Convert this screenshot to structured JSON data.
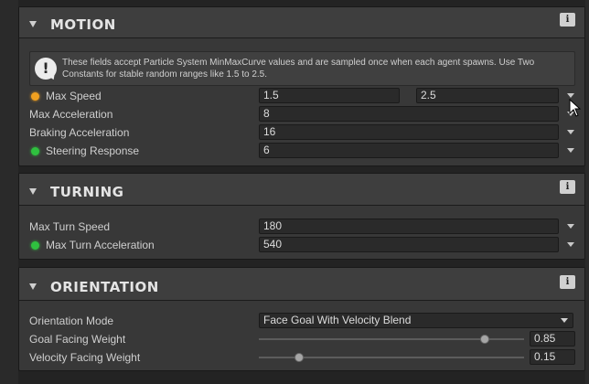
{
  "sections": {
    "motion": {
      "title": "MOTION",
      "info_label": "i",
      "note": "These fields accept Particle System MinMaxCurve values and are sampled once when each agent spawns. Use Two Constants for stable random ranges like 1.5 to 2.5.",
      "rows": [
        {
          "label": "Max Speed",
          "min": "1.5",
          "max": "2.5",
          "dot": "orange"
        },
        {
          "label": "Max Acceleration",
          "value": "8"
        },
        {
          "label": "Braking Acceleration",
          "value": "16"
        },
        {
          "label": "Steering Response",
          "value": "6",
          "dot": "green"
        }
      ]
    },
    "turning": {
      "title": "TURNING",
      "info_label": "i",
      "rows": [
        {
          "label": "Max Turn Speed",
          "value": "180"
        },
        {
          "label": "Max Turn Acceleration",
          "value": "540",
          "dot": "green"
        }
      ]
    },
    "orientation": {
      "title": "ORIENTATION",
      "info_label": "i",
      "rows": [
        {
          "label": "Orientation Mode",
          "value": "Face Goal With Velocity Blend"
        },
        {
          "label": "Goal Facing Weight",
          "value": "0.85",
          "fraction": 0.85
        },
        {
          "label": "Velocity Facing Weight",
          "value": "0.15",
          "fraction": 0.15
        }
      ]
    }
  },
  "colors": {
    "accent_orange": "#f0a020",
    "accent_green": "#2fc03f"
  },
  "icons": {
    "fold": "triangle-down",
    "info": "i-badge",
    "note": "speech-bubble-exclamation"
  }
}
